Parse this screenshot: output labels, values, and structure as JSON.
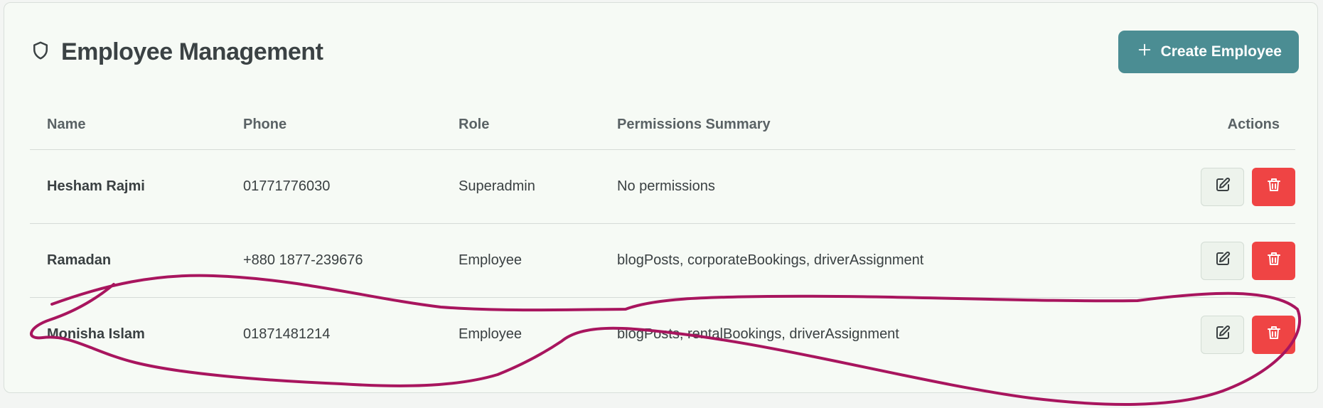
{
  "header": {
    "title": "Employee Management",
    "create_button_label": "Create Employee",
    "title_icon": "shield-icon",
    "create_icon": "plus-icon"
  },
  "table": {
    "columns": [
      "Name",
      "Phone",
      "Role",
      "Permissions Summary",
      "Actions"
    ],
    "rows": [
      {
        "name": "Hesham Rajmi",
        "phone": "01771776030",
        "role": "Superadmin",
        "permissions": "No permissions"
      },
      {
        "name": "Ramadan",
        "phone": "+880 1877-239676",
        "role": "Employee",
        "permissions": "blogPosts, corporateBookings, driverAssignment"
      },
      {
        "name": "Monisha Islam",
        "phone": "01871481214",
        "role": "Employee",
        "permissions": "blogPosts, rentalBookings, driverAssignment"
      }
    ],
    "row_action_icons": [
      "edit-icon",
      "trash-icon"
    ]
  },
  "colors": {
    "primary": "#4b8d93",
    "danger": "#ef4444",
    "card_background": "#f6faf5",
    "annotation_stroke": "#a8155e"
  },
  "annotation": {
    "type": "hand-drawn circle around row 3"
  }
}
